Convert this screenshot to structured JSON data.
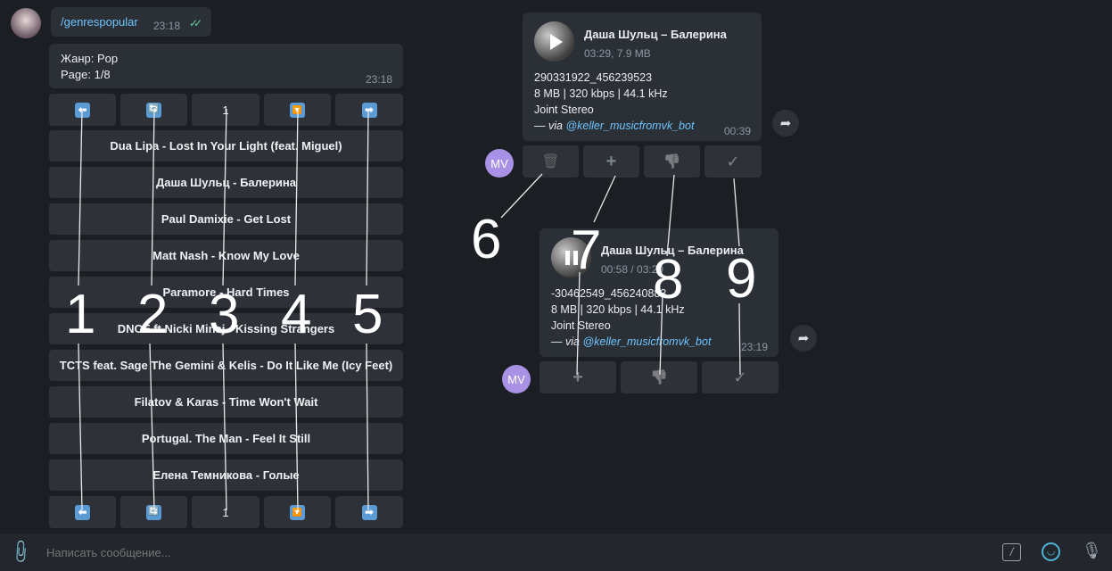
{
  "command": {
    "text": "/genrespopular",
    "time": "23:18"
  },
  "genre_msg": {
    "line1": "Жанр: Pop",
    "line2": "Page: 1/8",
    "time": "23:18"
  },
  "nav": {
    "prev": "⬅",
    "refresh": "🔄",
    "page": "1",
    "down": "🔽",
    "next": "➡"
  },
  "tracks": [
    "Dua Lipa - Lost In Your Light (feat. Miguel)",
    "Даша Шульц - Балерина",
    "Paul Damixie - Get Lost",
    "Matt Nash - Know My Love",
    "Paramore - Hard Times",
    "DNCE ft Nicki Minaj - Kissing Strangers",
    "TCTS feat. Sage The Gemini & Kelis - Do It Like Me (Icy Feet)",
    "Filatov & Karas - Time Won't Wait",
    "Portugal. The Man - Feel It Still",
    "Елена Темникова - Голые"
  ],
  "audio1": {
    "title": "Даша Шульц – Балерина",
    "meta": "03:29, 7.9 MB",
    "id": "290331922_456239523",
    "quality": "8 MB | 320 kbps | 44.1 kHz",
    "mode": "Joint Stereo",
    "via_prefix": "— via ",
    "via_bot": "@keller_musicfromvk_bot",
    "time": "00:39"
  },
  "audio2": {
    "title": "Даша Шульц – Балерина",
    "meta": "00:58 / 03:29",
    "id": "-30462549_456240883",
    "quality": "8 MB | 320 kbps | 44.1 kHz",
    "mode": "Joint Stereo",
    "via_prefix": "— via ",
    "via_bot": "@keller_musicfromvk_bot",
    "time": "23:19"
  },
  "actions": {
    "delete": "🗑",
    "add": "+",
    "dislike": "👎",
    "check": "✓"
  },
  "sender_initials": "MV",
  "annotations": [
    "1",
    "2",
    "3",
    "4",
    "5",
    "6",
    "7",
    "8",
    "9"
  ],
  "composer": {
    "placeholder": "Написать сообщение..."
  },
  "colors": {
    "background": "#1b1e23",
    "bubble": "#2b2f36",
    "button": "#2e3238",
    "link": "#6ec5ff",
    "avatar": "#a992e6"
  }
}
